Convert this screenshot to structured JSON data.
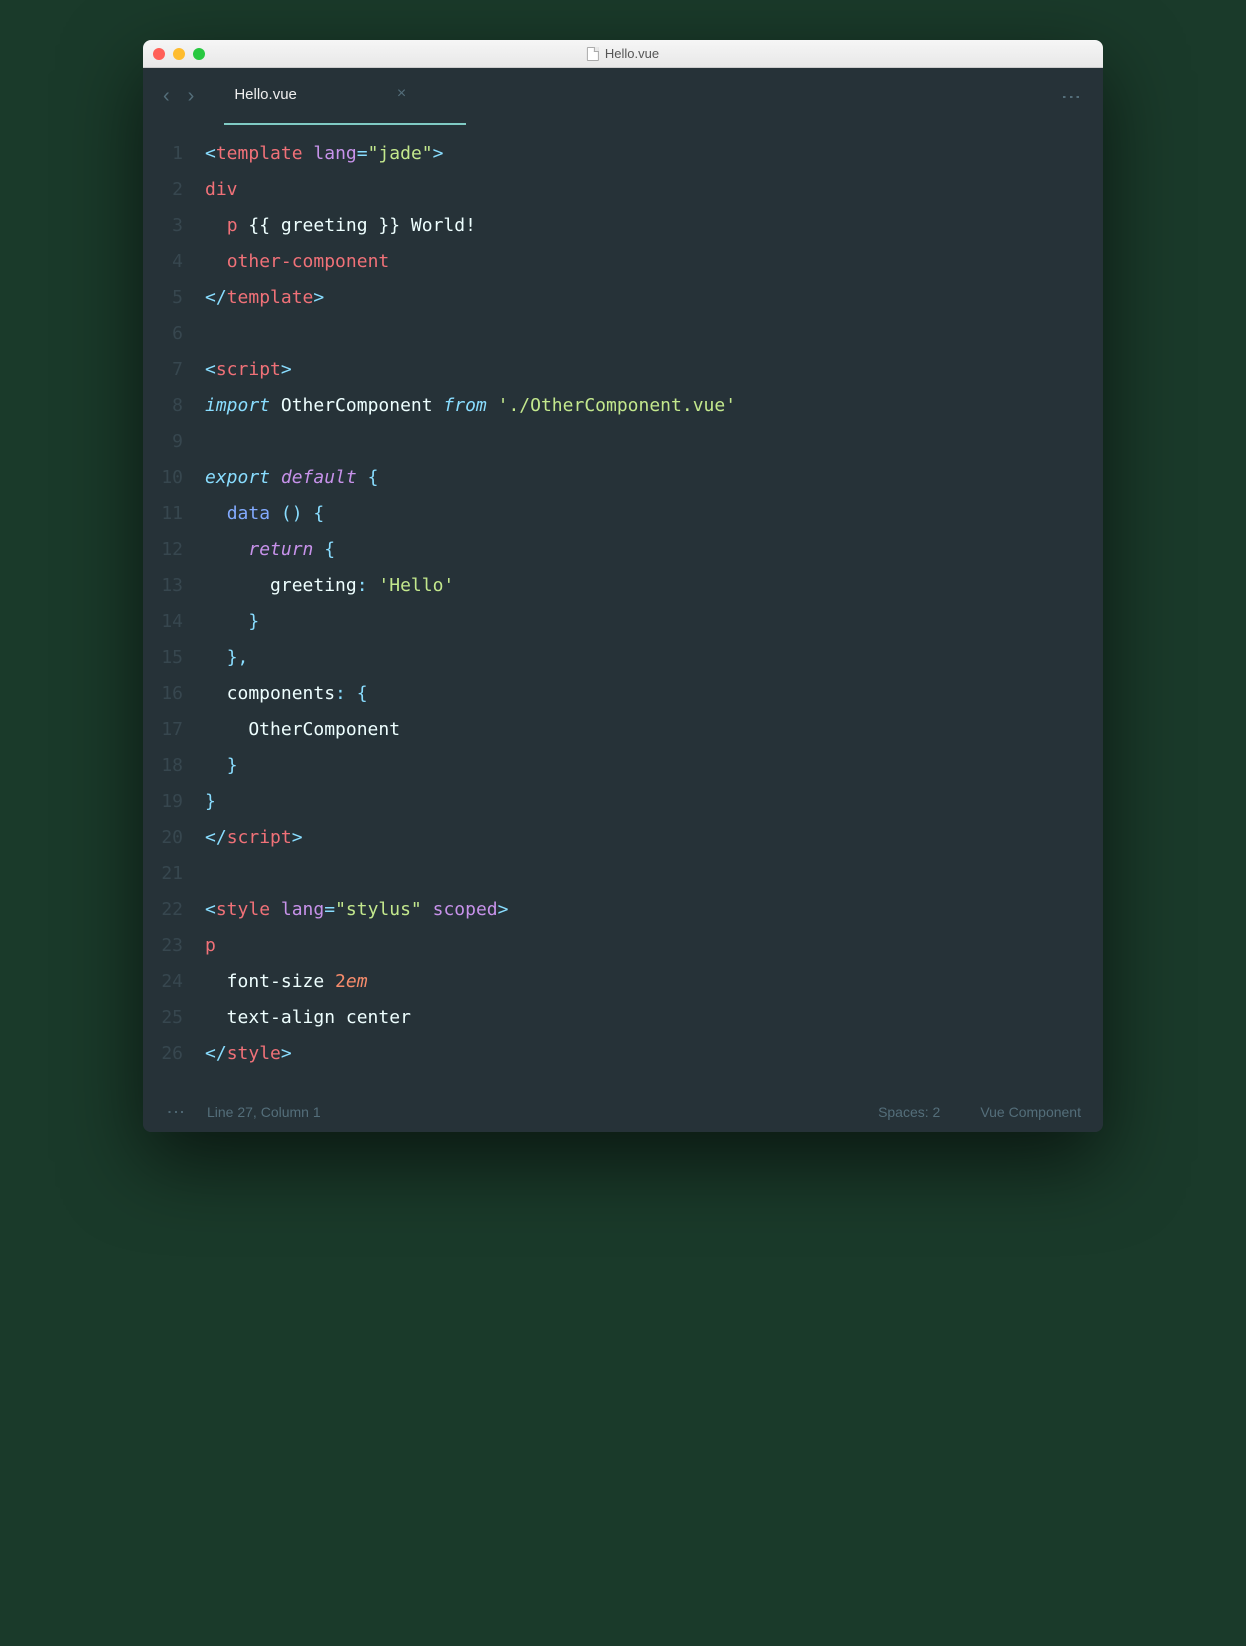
{
  "window": {
    "title": "Hello.vue"
  },
  "tab": {
    "name": "Hello.vue"
  },
  "code": {
    "lines": [
      {
        "n": "1",
        "tokens": [
          [
            "<",
            "c-punc"
          ],
          [
            "template",
            "c-tag"
          ],
          [
            " ",
            ""
          ],
          [
            "lang",
            "c-attr"
          ],
          [
            "=",
            "c-punc"
          ],
          [
            "\"jade\"",
            "c-str"
          ],
          [
            ">",
            "c-punc"
          ]
        ]
      },
      {
        "n": "2",
        "tokens": [
          [
            "div",
            "c-tag"
          ]
        ]
      },
      {
        "n": "3",
        "tokens": [
          [
            "  ",
            ""
          ],
          [
            "p",
            "c-tag"
          ],
          [
            " {{ greeting }} World!",
            "c-white"
          ]
        ]
      },
      {
        "n": "4",
        "tokens": [
          [
            "  ",
            ""
          ],
          [
            "other-component",
            "c-tag"
          ]
        ]
      },
      {
        "n": "5",
        "tokens": [
          [
            "</",
            "c-punc"
          ],
          [
            "template",
            "c-tag"
          ],
          [
            ">",
            "c-punc"
          ]
        ]
      },
      {
        "n": "6",
        "tokens": []
      },
      {
        "n": "7",
        "tokens": [
          [
            "<",
            "c-punc"
          ],
          [
            "script",
            "c-tag"
          ],
          [
            ">",
            "c-punc"
          ]
        ]
      },
      {
        "n": "8",
        "tokens": [
          [
            "import",
            "c-kw"
          ],
          [
            " OtherComponent ",
            "c-white"
          ],
          [
            "from",
            "c-kw"
          ],
          [
            " ",
            ""
          ],
          [
            "'./OtherComponent.vue'",
            "c-str"
          ]
        ]
      },
      {
        "n": "9",
        "tokens": []
      },
      {
        "n": "10",
        "tokens": [
          [
            "export",
            "c-kw"
          ],
          [
            " ",
            ""
          ],
          [
            "default",
            "c-kw2"
          ],
          [
            " ",
            ""
          ],
          [
            "{",
            "c-punc"
          ]
        ]
      },
      {
        "n": "11",
        "tokens": [
          [
            "  ",
            ""
          ],
          [
            "data",
            "c-fn"
          ],
          [
            " ",
            ""
          ],
          [
            "()",
            "c-punc"
          ],
          [
            " ",
            ""
          ],
          [
            "{",
            "c-punc"
          ]
        ]
      },
      {
        "n": "12",
        "tokens": [
          [
            "    ",
            ""
          ],
          [
            "return",
            "c-kw2"
          ],
          [
            " ",
            ""
          ],
          [
            "{",
            "c-punc"
          ]
        ]
      },
      {
        "n": "13",
        "tokens": [
          [
            "      greeting",
            ""
          ],
          [
            ":",
            "c-punc"
          ],
          [
            " ",
            ""
          ],
          [
            "'Hello'",
            "c-str"
          ]
        ]
      },
      {
        "n": "14",
        "tokens": [
          [
            "    ",
            ""
          ],
          [
            "}",
            "c-punc"
          ]
        ]
      },
      {
        "n": "15",
        "tokens": [
          [
            "  ",
            ""
          ],
          [
            "},",
            "c-punc"
          ]
        ]
      },
      {
        "n": "16",
        "tokens": [
          [
            "  components",
            ""
          ],
          [
            ":",
            "c-punc"
          ],
          [
            " ",
            ""
          ],
          [
            "{",
            "c-punc"
          ]
        ]
      },
      {
        "n": "17",
        "tokens": [
          [
            "    OtherComponent",
            "c-white"
          ]
        ]
      },
      {
        "n": "18",
        "tokens": [
          [
            "  ",
            ""
          ],
          [
            "}",
            "c-punc"
          ]
        ]
      },
      {
        "n": "19",
        "tokens": [
          [
            "}",
            "c-punc"
          ]
        ]
      },
      {
        "n": "20",
        "tokens": [
          [
            "</",
            "c-punc"
          ],
          [
            "script",
            "c-tag"
          ],
          [
            ">",
            "c-punc"
          ]
        ]
      },
      {
        "n": "21",
        "tokens": []
      },
      {
        "n": "22",
        "tokens": [
          [
            "<",
            "c-punc"
          ],
          [
            "style",
            "c-tag"
          ],
          [
            " ",
            ""
          ],
          [
            "lang",
            "c-attr"
          ],
          [
            "=",
            "c-punc"
          ],
          [
            "\"stylus\"",
            "c-str"
          ],
          [
            " ",
            ""
          ],
          [
            "scoped",
            "c-attr"
          ],
          [
            ">",
            "c-punc"
          ]
        ]
      },
      {
        "n": "23",
        "tokens": [
          [
            "p",
            "c-tag"
          ]
        ]
      },
      {
        "n": "24",
        "tokens": [
          [
            "  font-size ",
            "c-white"
          ],
          [
            "2",
            "c-num"
          ],
          [
            "em",
            "c-numit"
          ]
        ]
      },
      {
        "n": "25",
        "tokens": [
          [
            "  text-align center",
            "c-white"
          ]
        ]
      },
      {
        "n": "26",
        "tokens": [
          [
            "</",
            "c-punc"
          ],
          [
            "style",
            "c-tag"
          ],
          [
            ">",
            "c-punc"
          ]
        ]
      }
    ]
  },
  "status": {
    "position": "Line 27, Column 1",
    "spaces": "Spaces: 2",
    "syntax": "Vue Component"
  }
}
